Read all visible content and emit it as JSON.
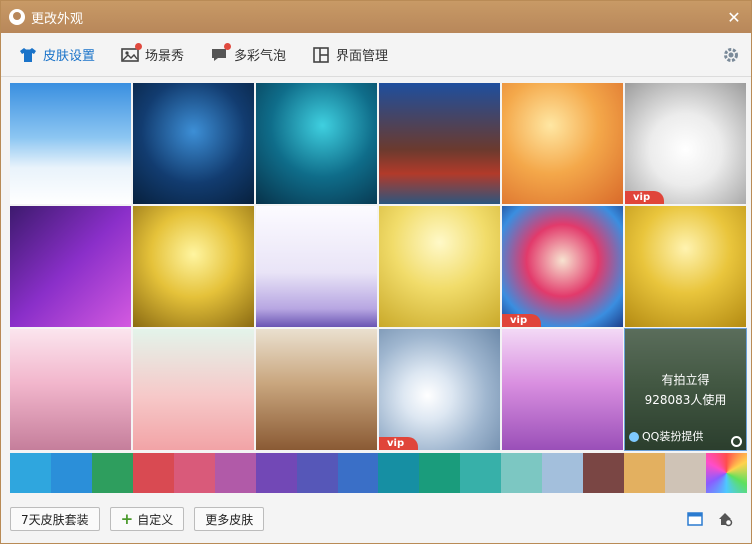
{
  "window": {
    "title": "更改外观"
  },
  "tabs": [
    {
      "label": "皮肤设置",
      "icon": "shirt-icon",
      "active": true
    },
    {
      "label": "场景秀",
      "icon": "picture-icon",
      "badge": true
    },
    {
      "label": "多彩气泡",
      "icon": "bubble-icon",
      "badge": true
    },
    {
      "label": "界面管理",
      "icon": "layout-icon"
    }
  ],
  "vip_label": "vip",
  "featured": {
    "title": "有拍立得",
    "users": "928083人使用",
    "provider": "QQ装扮提供"
  },
  "swatches": [
    "#2fa6de",
    "#2b8fd9",
    "#2e9e5e",
    "#d94a52",
    "#d95a7a",
    "#b15aa8",
    "#7248b6",
    "#5657b8",
    "#3a6fc7",
    "#168fa3",
    "#1a9c7c",
    "#37b0a9",
    "#7cc7c2",
    "#a3bfdc",
    "#7a4644",
    "#e3b060",
    "#cfc3b6",
    "rainbow"
  ],
  "buttons": {
    "weekly": "7天皮肤套装",
    "custom": "自定义",
    "more": "更多皮肤"
  }
}
